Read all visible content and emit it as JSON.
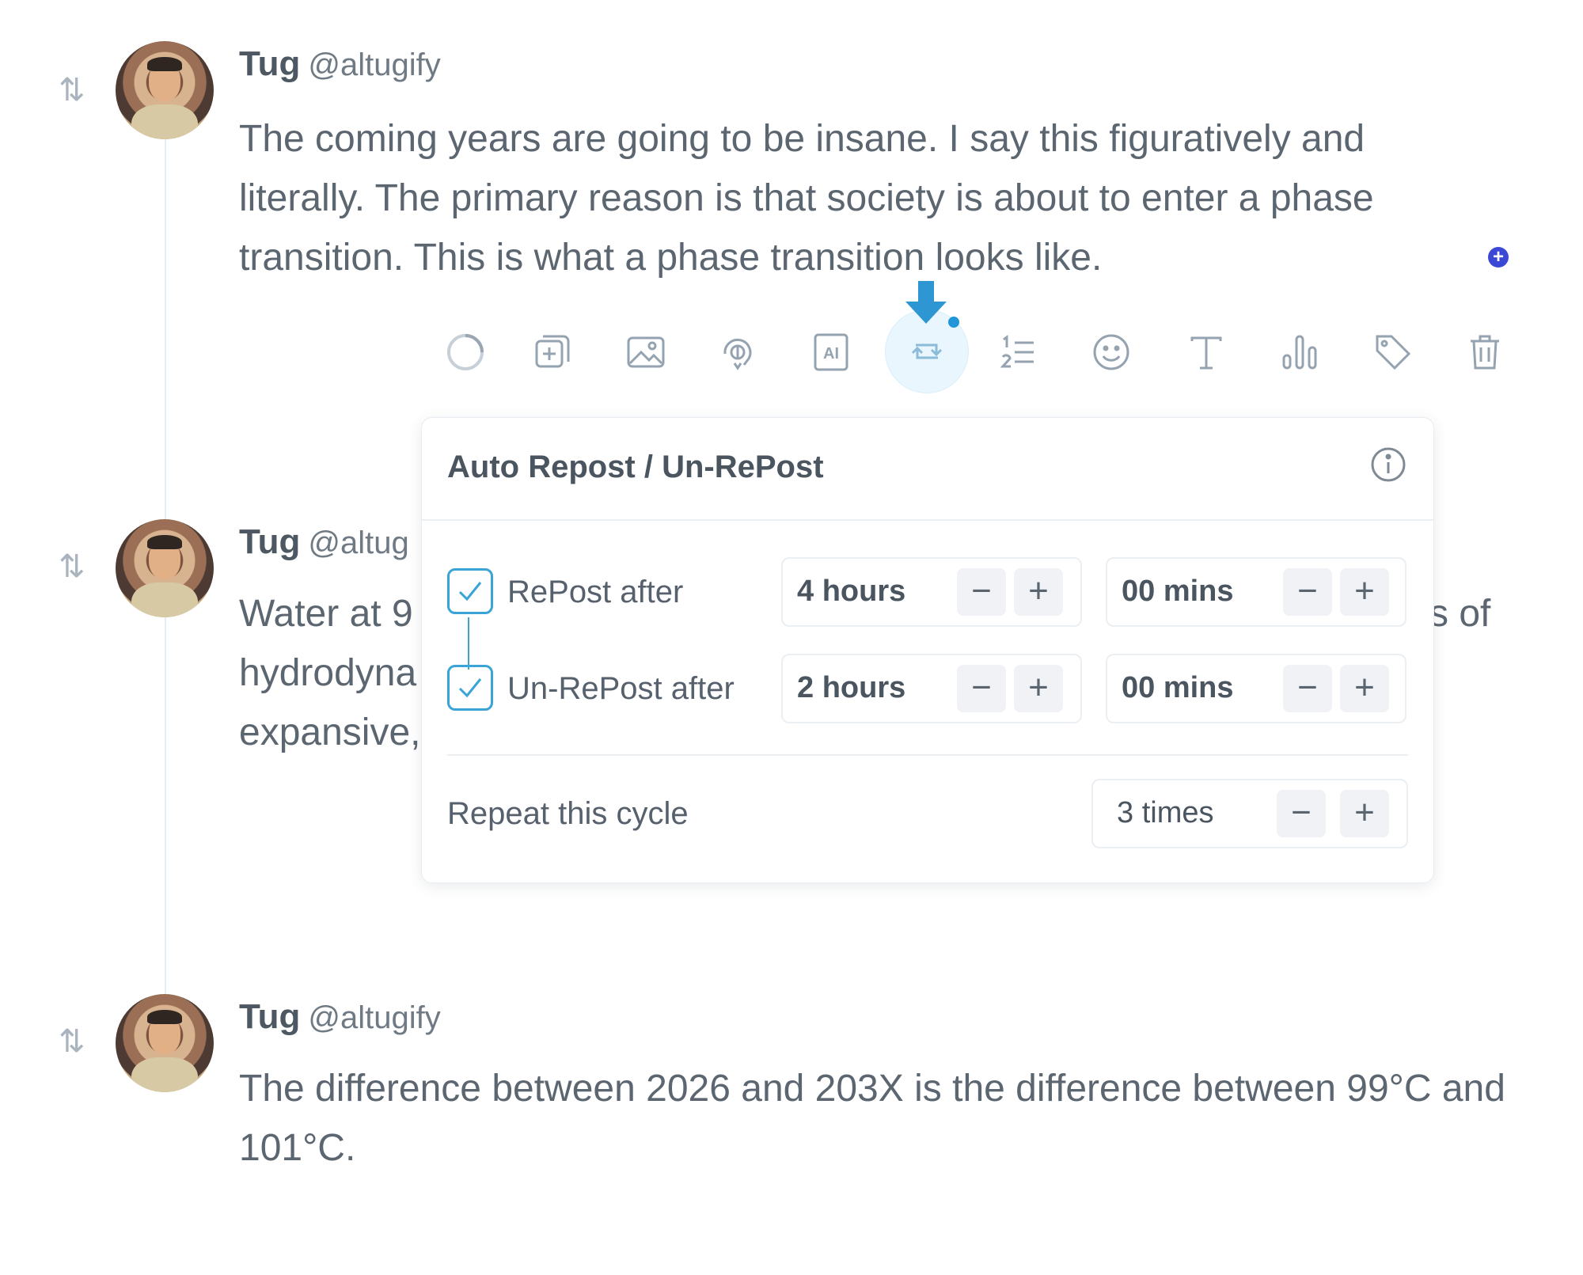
{
  "posts": [
    {
      "name": "Tug",
      "handle": "@altugify",
      "text": "The coming years are going to be insane. I say this figuratively and literally. The primary reason is that society is about to enter a phase transition.  This is what a phase transition looks like."
    },
    {
      "name": "Tug",
      "handle": "@altug",
      "line1": "Water at 9",
      "line1_tail": "s of",
      "line2": "hydrodyna",
      "line3": "expansive,"
    },
    {
      "name": "Tug",
      "handle": "@altugify",
      "text": "The difference between 2026 and 203X is the difference between 99°C and 101°C."
    }
  ],
  "toolbar": {
    "tools": [
      "loading-circle-icon",
      "add-post-icon",
      "image-icon",
      "gif-icon",
      "ai-icon",
      "auto-repost-icon",
      "numbered-list-icon",
      "emoji-icon",
      "text-format-icon",
      "poll-icon",
      "tag-icon",
      "trash-icon"
    ],
    "active": "auto-repost-icon",
    "ai_label": "AI"
  },
  "panel": {
    "title": "Auto Repost / Un-RePost",
    "repost_label": "RePost after",
    "repost_checked": true,
    "repost_hours": "4 hours",
    "repost_mins": "00 mins",
    "unrepost_label": "Un-RePost after",
    "unrepost_checked": true,
    "unrepost_hours": "2 hours",
    "unrepost_mins": "00 mins",
    "repeat_label": "Repeat this cycle",
    "repeat_value": "3 times",
    "minus": "−",
    "plus": "+"
  },
  "colors": {
    "accent": "#3aa4d6",
    "active_dot": "#2196d9",
    "add_dot": "#3b48d6"
  }
}
